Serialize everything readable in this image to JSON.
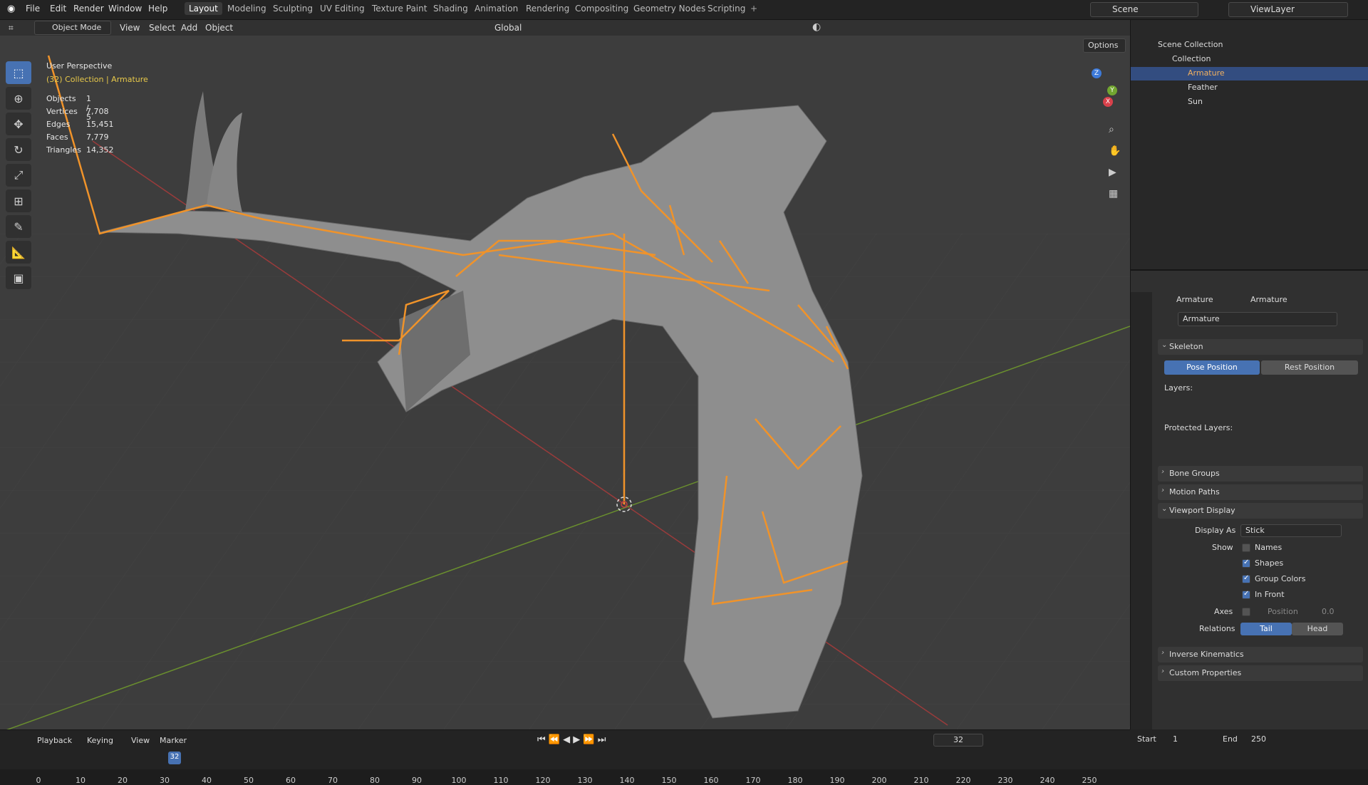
{
  "menu": [
    "File",
    "Edit",
    "Render",
    "Window",
    "Help"
  ],
  "workspaces": [
    "Layout",
    "Modeling",
    "Sculpting",
    "UV Editing",
    "Texture Paint",
    "Shading",
    "Animation",
    "Rendering",
    "Compositing",
    "Geometry Nodes",
    "Scripting"
  ],
  "active_workspace": "Layout",
  "scene": "Scene",
  "view_layer": "ViewLayer",
  "viewport": {
    "mode": "Object Mode",
    "menus": [
      "View",
      "Select",
      "Add",
      "Object"
    ],
    "orientation": "Global",
    "options": "Options",
    "overlay_title": "User Perspective",
    "overlay_sub": "(32) Collection | Armature",
    "stats": [
      {
        "k": "Objects",
        "v": "1 / 5"
      },
      {
        "k": "Vertices",
        "v": "7,708"
      },
      {
        "k": "Edges",
        "v": "15,451"
      },
      {
        "k": "Faces",
        "v": "7,779"
      },
      {
        "k": "Triangles",
        "v": "14,352"
      }
    ],
    "gizmo": {
      "x": "X",
      "y": "Y",
      "z": "Z"
    }
  },
  "outliner": {
    "root": "Scene Collection",
    "collection": "Collection",
    "items": [
      "Armature",
      "Feather",
      "Sun"
    ]
  },
  "props": {
    "breadcrumb_a": "Armature",
    "breadcrumb_b": "Armature",
    "datablock": "Armature",
    "skeleton": "Skeleton",
    "pose_position": "Pose Position",
    "rest_position": "Rest Position",
    "layers": "Layers:",
    "protected_layers": "Protected Layers:",
    "bone_groups": "Bone Groups",
    "motion_paths": "Motion Paths",
    "viewport_display": "Viewport Display",
    "display_as_label": "Display As",
    "display_as_value": "Stick",
    "show_label": "Show",
    "names": "Names",
    "shapes": "Shapes",
    "group_colors": "Group Colors",
    "in_front": "In Front",
    "axes": "Axes",
    "position": "Position",
    "position_value": "0.0",
    "relations": "Relations",
    "tail": "Tail",
    "head": "Head",
    "ik": "Inverse Kinematics",
    "custom_props": "Custom Properties"
  },
  "timeline": {
    "menus": [
      "Playback",
      "Keying",
      "View",
      "Marker"
    ],
    "current_frame": "32",
    "start_label": "Start",
    "start": "1",
    "end_label": "End",
    "end": "250",
    "ticks": [
      "0",
      "10",
      "20",
      "30",
      "40",
      "50",
      "60",
      "70",
      "80",
      "90",
      "100",
      "110",
      "120",
      "130",
      "140",
      "150",
      "160",
      "170",
      "180",
      "190",
      "200",
      "210",
      "220",
      "230",
      "240",
      "250"
    ]
  }
}
